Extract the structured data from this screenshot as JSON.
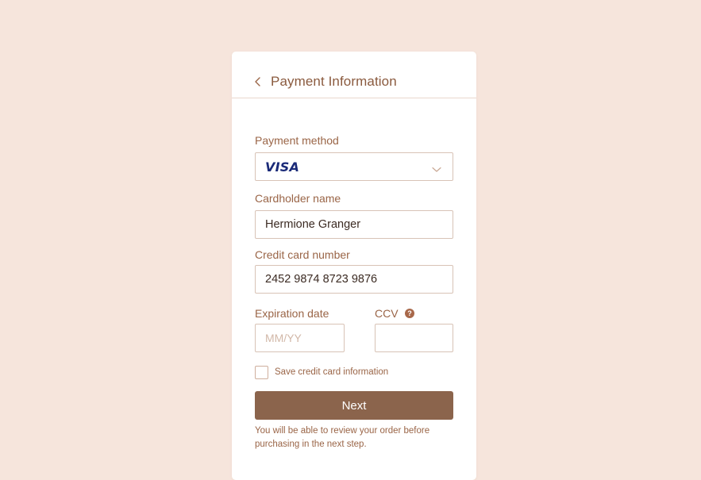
{
  "header": {
    "title": "Payment Information"
  },
  "form": {
    "payment_method": {
      "label": "Payment method",
      "selected": "VISA"
    },
    "cardholder_name": {
      "label": "Cardholder name",
      "value": "Hermione Granger"
    },
    "card_number": {
      "label": "Credit card number",
      "value": "2452 9874 8723 9876"
    },
    "expiration": {
      "label": "Expiration date",
      "placeholder": "MM/YY",
      "value": ""
    },
    "ccv": {
      "label": "CCV",
      "help_glyph": "?",
      "value": ""
    },
    "save_card": {
      "label": "Save credit card information",
      "checked": false
    },
    "next_label": "Next",
    "footnote": "You will be able to review your order before purchasing in the next step."
  },
  "icons": {
    "back": "chevron-left-icon",
    "dropdown": "chevron-down-icon",
    "help": "help-icon"
  },
  "colors": {
    "background": "#f6e5dc",
    "accent": "#8b644c",
    "label_text": "#9a6547",
    "visa": "#1a2a78"
  }
}
